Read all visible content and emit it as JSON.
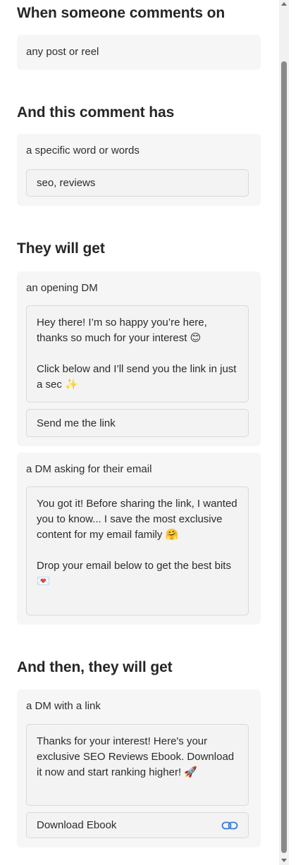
{
  "trigger": {
    "heading": "When someone comments on",
    "value": "any post or reel"
  },
  "condition": {
    "heading": "And this comment has",
    "label": "a specific word or words",
    "keywords": "seo, reviews"
  },
  "response": {
    "heading": "They will get",
    "opening_dm": {
      "label": "an opening DM",
      "message": "Hey there! I’m so happy you’re here, thanks so much for your interest 😊\n\nClick below and I’ll send you the link in just a sec ✨",
      "button_label": "Send me the link"
    },
    "email_dm": {
      "label": "a DM asking for their email",
      "message": "You got it! Before sharing the link, I wanted you to know... I save the most exclusive content for my email family 🤗\n\nDrop your email below to get the best bits  💌"
    }
  },
  "followup": {
    "heading": "And then, they will get",
    "link_dm": {
      "label": "a DM with a link",
      "message": "Thanks for your interest! Here's your exclusive SEO Reviews Ebook. Download it now and start ranking higher! 🚀",
      "button_label": "Download Ebook",
      "button_icon": "link-icon"
    }
  },
  "colors": {
    "link_icon": "#3b7bd6",
    "card_bg": "#f6f6f6",
    "scroll_thumb": "#8a8a8a"
  }
}
